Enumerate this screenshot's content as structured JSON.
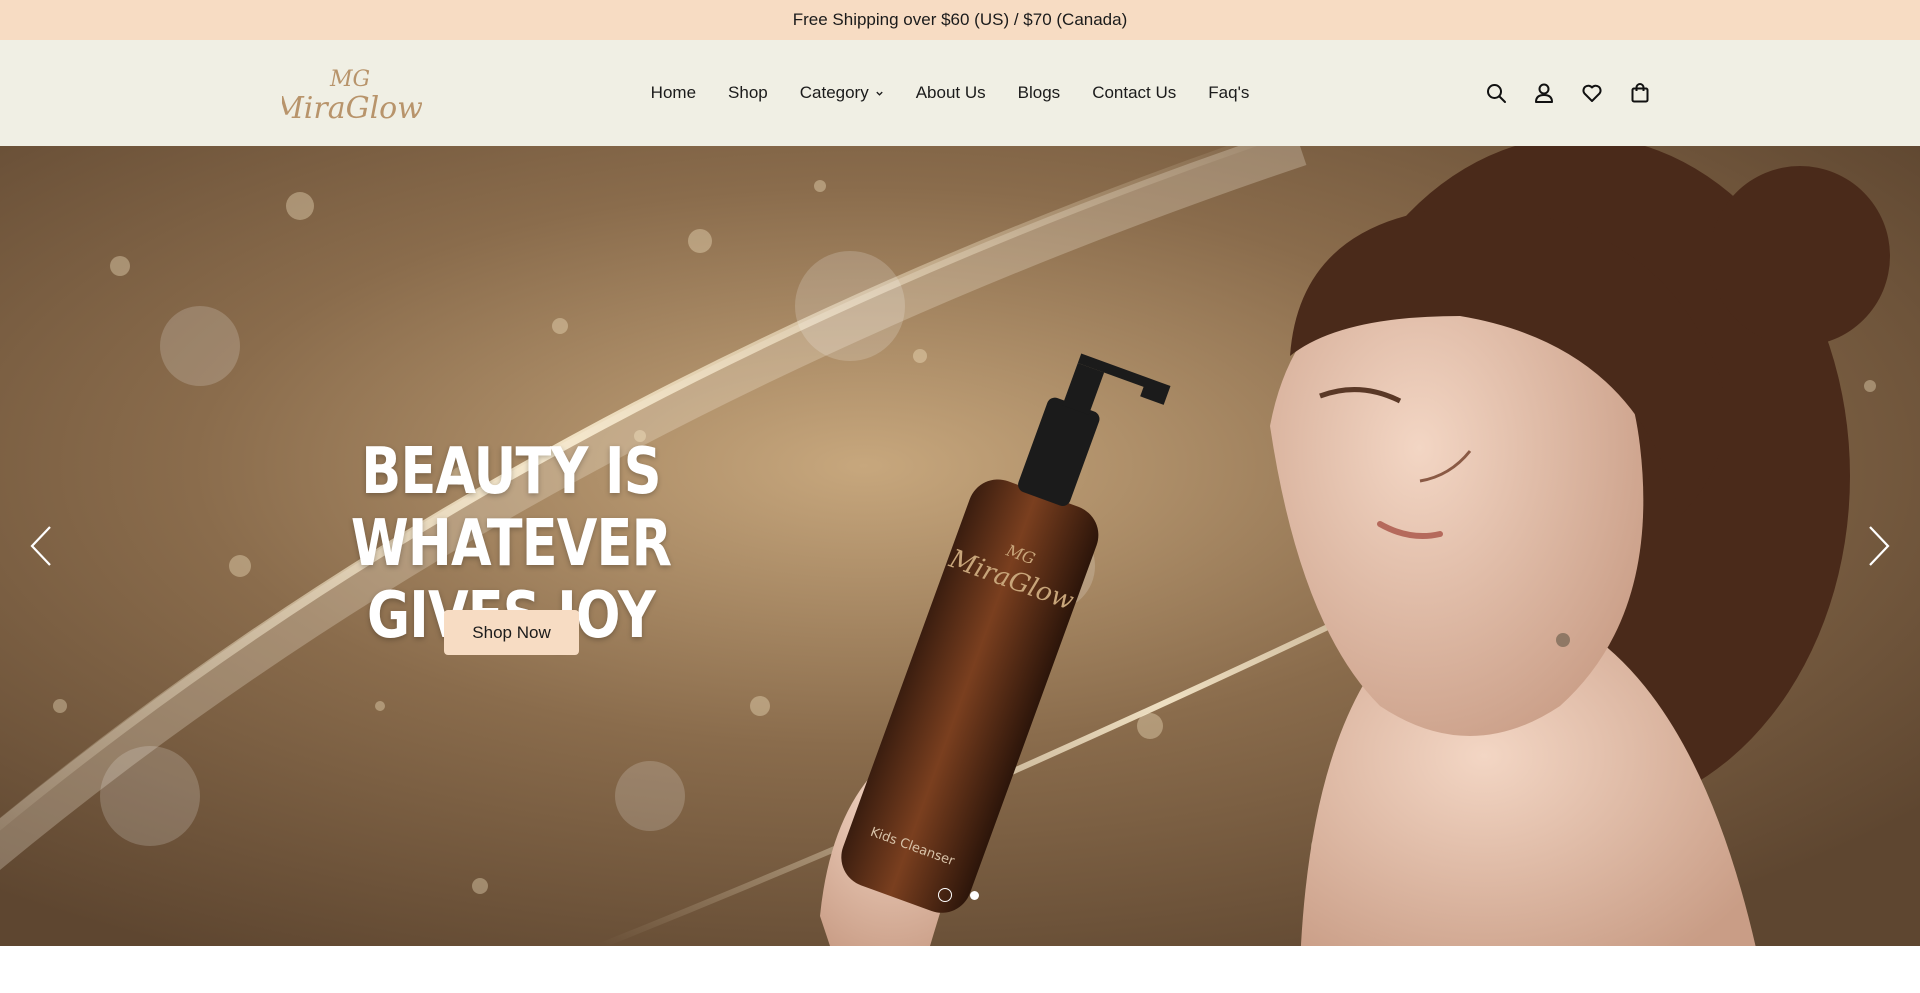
{
  "announcement": {
    "text": "Free Shipping over $60 (US) / $70 (Canada)"
  },
  "header": {
    "logo": {
      "monogram": "MG",
      "name": "MiraGlow"
    },
    "nav": [
      {
        "label": "Home"
      },
      {
        "label": "Shop"
      },
      {
        "label": "Category",
        "has_dropdown": true
      },
      {
        "label": "About Us"
      },
      {
        "label": "Blogs"
      },
      {
        "label": "Contact Us"
      },
      {
        "label": "Faq's"
      }
    ],
    "icons": [
      "search-icon",
      "account-icon",
      "wishlist-icon",
      "cart-icon"
    ]
  },
  "hero": {
    "title_line1": "BEAUTY IS WHATEVER",
    "title_line2": "GIVES JOY",
    "cta_label": "Shop Now",
    "product_label_monogram": "MG",
    "product_label_name": "MiraGlow",
    "product_label_sub": "Kids Cleanser",
    "slides_total": 2,
    "active_slide": 2
  },
  "colors": {
    "accent_peach": "#f7dcc3",
    "header_bg": "#f0efe4",
    "logo_gold": "#b8946b"
  }
}
